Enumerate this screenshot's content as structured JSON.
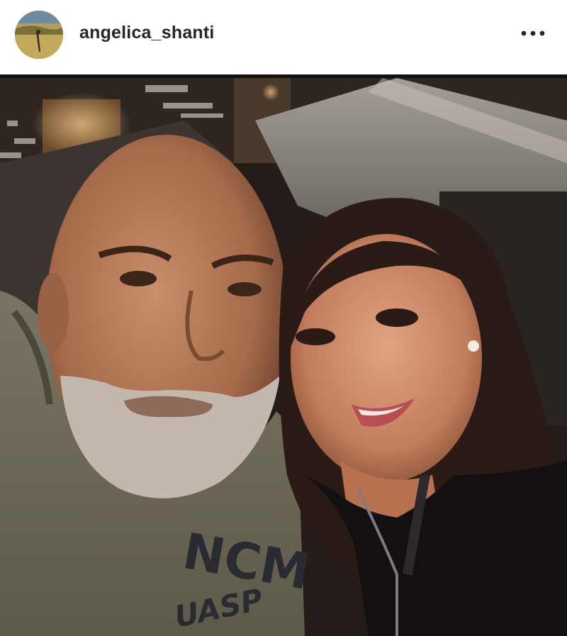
{
  "post": {
    "username": "angelica_shanti",
    "more_icon": "ellipsis-horizontal-icon",
    "avatar_icon": "profile-avatar",
    "photo": {
      "description_icon": "post-photo",
      "shirt_text_top": "NCM",
      "shirt_text_bottom": "UASP"
    }
  },
  "colors": {
    "text_primary": "#262626",
    "header_bg": "#ffffff",
    "divider": "#111111"
  }
}
